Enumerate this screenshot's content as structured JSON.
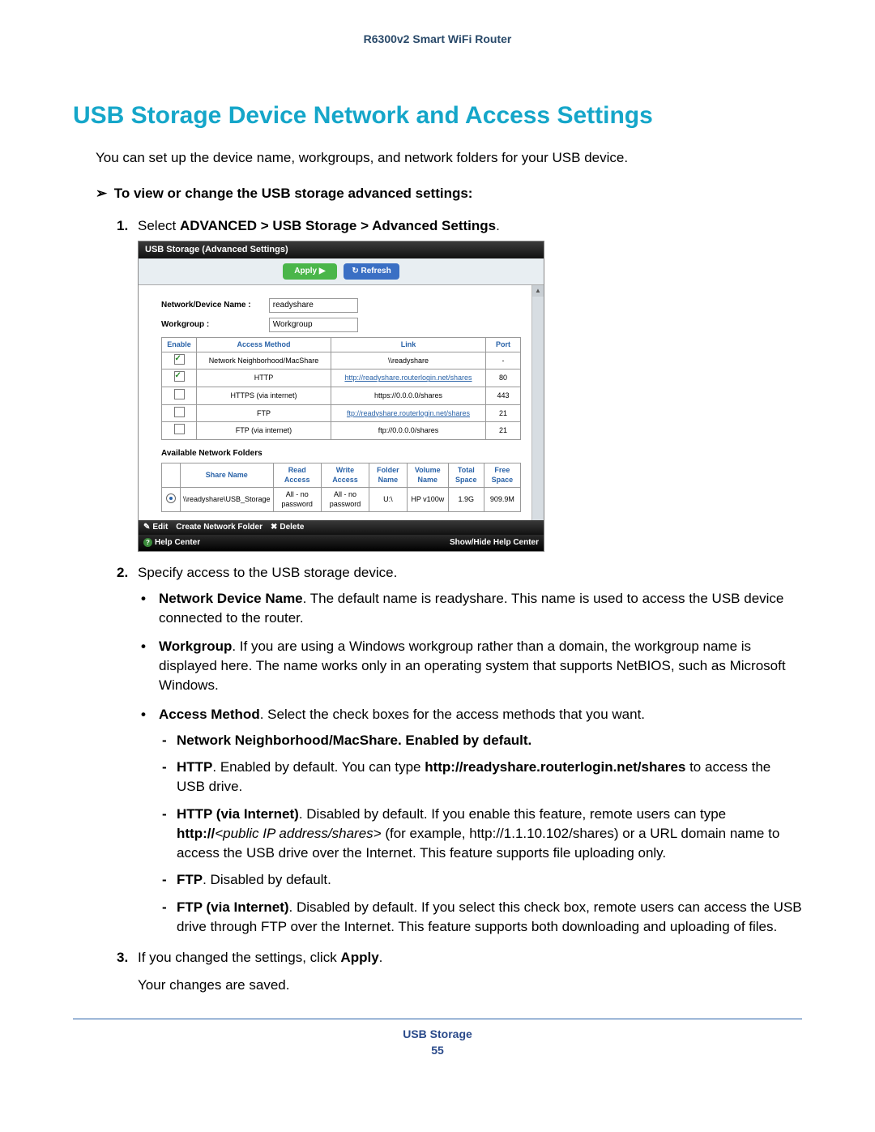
{
  "header": {
    "product": "R6300v2 Smart WiFi Router"
  },
  "title": "USB Storage Device Network and Access Settings",
  "intro": "You can set up the device name, workgroups, and network folders for your USB device.",
  "procedure_heading": "To view or change the USB storage advanced settings:",
  "steps": {
    "s1_prefix": "Select ",
    "s1_bold": "ADVANCED > USB Storage > Advanced Settings",
    "s1_suffix": ".",
    "s2": "Specify access to the USB storage device.",
    "s3_prefix": "If you changed the settings, click ",
    "s3_bold": "Apply",
    "s3_suffix": ".",
    "s3_followup": "Your changes are saved."
  },
  "bullets": {
    "ndn_label": "Network Device Name",
    "ndn_text": ". The default name is readyshare. This name is used to access the USB device connected to the router.",
    "wg_label": "Workgroup",
    "wg_text": ". If you are using a Windows workgroup rather than a domain, the workgroup name is displayed here. The name works only in an operating system that supports NetBIOS, such as Microsoft Windows.",
    "am_label": "Access Method",
    "am_text": ". Select the check boxes for the access methods that you want."
  },
  "dashes": {
    "d1": "Network Neighborhood/MacShare. Enabled by default.",
    "d2_label": "HTTP",
    "d2_mid": ". Enabled by default. You can type ",
    "d2_url": "http://readyshare.routerlogin.net/shares",
    "d2_end": " to access the USB drive.",
    "d3_label": "HTTP (via Internet)",
    "d3_a": ". Disabled by default. If you enable this feature, remote users can type ",
    "d3_b": "http://",
    "d3_c": "<public IP address/shares>",
    "d3_d": " (for example, http://1.1.10.102/shares) or a URL domain name to access the USB drive over the Internet. This feature supports file uploading only.",
    "d4_label": "FTP",
    "d4_text": ". Disabled by default.",
    "d5_label": "FTP (via Internet)",
    "d5_text": ". Disabled by default. If you select this check box, remote users can access the USB drive through FTP over the Internet. This feature supports both downloading and uploading of files."
  },
  "screenshot": {
    "titlebar": "USB Storage (Advanced Settings)",
    "btn_apply": "Apply ▶",
    "btn_refresh": "↻ Refresh",
    "fld_ndn_label": "Network/Device Name :",
    "fld_ndn_value": "readyshare",
    "fld_wg_label": "Workgroup :",
    "fld_wg_value": "Workgroup",
    "tbl_headers": {
      "enable": "Enable",
      "method": "Access Method",
      "link": "Link",
      "port": "Port"
    },
    "rows": [
      {
        "on": true,
        "method": "Network Neighborhood/MacShare",
        "link": "\\\\readyshare",
        "link_is_link": false,
        "port": "-"
      },
      {
        "on": true,
        "method": "HTTP",
        "link": "http://readyshare.routerlogin.net/shares",
        "link_is_link": true,
        "port": "80"
      },
      {
        "on": false,
        "method": "HTTPS (via internet)",
        "link": "https://0.0.0.0/shares",
        "link_is_link": false,
        "port": "443"
      },
      {
        "on": false,
        "method": "FTP",
        "link": "ftp://readyshare.routerlogin.net/shares",
        "link_is_link": true,
        "port": "21"
      },
      {
        "on": false,
        "method": "FTP (via internet)",
        "link": "ftp://0.0.0.0/shares",
        "link_is_link": false,
        "port": "21"
      }
    ],
    "folders_label": "Available Network Folders",
    "folders_headers": {
      "blank": "",
      "share": "Share Name",
      "read": "Read Access",
      "write": "Write Access",
      "folder": "Folder Name",
      "volume": "Volume Name",
      "total": "Total Space",
      "free": "Free Space"
    },
    "folders_row": {
      "share": "\\\\readyshare\\USB_Storage",
      "read": "All - no password",
      "write": "All - no password",
      "folder": "U:\\",
      "volume": "HP v100w",
      "total": "1.9G",
      "free": "909.9M"
    },
    "actions": {
      "edit": "Edit",
      "create": "Create Network Folder",
      "delete": "Delete"
    },
    "helpbar_left": "Help Center",
    "helpbar_right": "Show/Hide Help Center"
  },
  "footer": {
    "section": "USB Storage",
    "page": "55"
  }
}
